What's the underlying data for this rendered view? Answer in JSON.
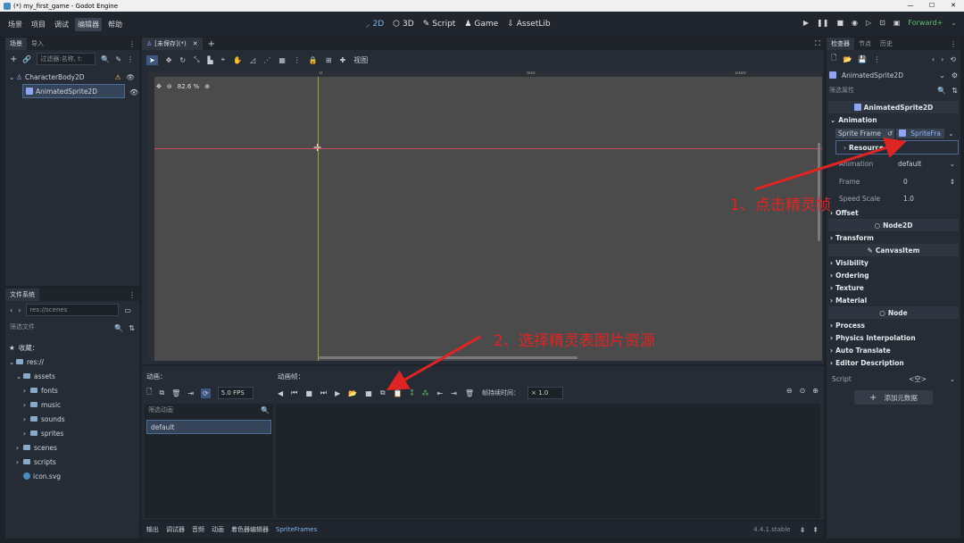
{
  "window": {
    "title": "(*) my_first_game - Godot Engine",
    "minimize": "—",
    "maximize": "☐",
    "close": "✕"
  },
  "menubar": {
    "items": [
      "场景",
      "项目",
      "调试",
      "编辑器",
      "帮助"
    ],
    "active_index": 3,
    "workspaces": [
      "2D",
      "3D",
      "Script",
      "Game",
      "AssetLib"
    ],
    "active_workspace": "2D",
    "renderer": "Forward+"
  },
  "scene_dock": {
    "tabs": [
      "场景",
      "导入"
    ],
    "filter_placeholder": "过滤器:名称, t:",
    "nodes": [
      {
        "name": "CharacterBody2D",
        "warning": true
      },
      {
        "name": "AnimatedSprite2D",
        "selected": true
      }
    ]
  },
  "filesystem_dock": {
    "tab": "文件系统",
    "path": "res://scenes",
    "filter_placeholder": "筛选文件",
    "favorites": "收藏：",
    "items": [
      {
        "label": "res://",
        "indent": 0,
        "type": "folder"
      },
      {
        "label": "assets",
        "indent": 1,
        "type": "folder"
      },
      {
        "label": "fonts",
        "indent": 2,
        "type": "folder"
      },
      {
        "label": "music",
        "indent": 2,
        "type": "folder"
      },
      {
        "label": "sounds",
        "indent": 2,
        "type": "folder"
      },
      {
        "label": "sprites",
        "indent": 2,
        "type": "folder"
      },
      {
        "label": "scenes",
        "indent": 1,
        "type": "folder"
      },
      {
        "label": "scripts",
        "indent": 1,
        "type": "folder"
      },
      {
        "label": "icon.svg",
        "indent": 1,
        "type": "file"
      }
    ]
  },
  "editor": {
    "scene_tab": "[未保存](*)",
    "zoom": "82.6 %",
    "view_menu": "视图",
    "ruler_marks": [
      "0",
      "500",
      "1000"
    ]
  },
  "sprite_frames": {
    "animations_label": "动画：",
    "frames_label": "动画帧：",
    "fps": "5.0 FPS",
    "frame_duration_label": "帧持续时间：",
    "frame_duration": "× 1.0",
    "filter_placeholder": "筛选动画",
    "animations": [
      "default"
    ]
  },
  "bottom_bar": {
    "tabs": [
      "输出",
      "调试器",
      "音频",
      "动画",
      "着色器编辑器",
      "SpriteFrames"
    ],
    "active": "SpriteFrames",
    "version": "4.4.1.stable"
  },
  "inspector": {
    "tabs": [
      "检查器",
      "节点",
      "历史"
    ],
    "object": "AnimatedSprite2D",
    "filter_placeholder": "筛选属性",
    "class_header": "AnimatedSprite2D",
    "animation_group": "Animation",
    "sprite_frames_label": "Sprite Frame",
    "sprite_frames_value": "SpriteFra",
    "resource_label": "Resource",
    "animation_prop": "Animation",
    "animation_value": "default",
    "frame_prop": "Frame",
    "frame_value": "0",
    "speed_prop": "Speed Scale",
    "speed_value": "1.0",
    "offset_group": "Offset",
    "node2d_header": "Node2D",
    "transform_group": "Transform",
    "canvasitem_header": "CanvasItem",
    "canvasitem_groups": [
      "Visibility",
      "Ordering",
      "Texture",
      "Material"
    ],
    "node_header": "Node",
    "node_groups": [
      "Process",
      "Physics Interpolation",
      "Auto Translate",
      "Editor Description"
    ],
    "script_label": "Script",
    "script_value": "<空>",
    "add_metadata": "添加元数据"
  },
  "annotations": {
    "step1": "1、点击精灵帧",
    "step2": "2、选择精灵表图片资源"
  },
  "colors": {
    "accent": "#478cbf",
    "annotation": "#e02424",
    "viewport": "#4b4b4b",
    "renderer": "#5fbf6a"
  }
}
